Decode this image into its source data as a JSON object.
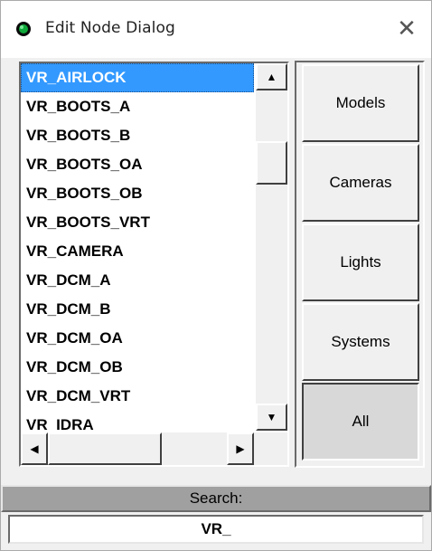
{
  "window": {
    "title": "Edit Node Dialog",
    "close_glyph": "✕",
    "icon": "green-sphere-icon"
  },
  "node_list": {
    "items": [
      "VR_AIRLOCK",
      "VR_BOOTS_A",
      "VR_BOOTS_B",
      "VR_BOOTS_OA",
      "VR_BOOTS_OB",
      "VR_BOOTS_VRT",
      "VR_CAMERA",
      "VR_DCM_A",
      "VR_DCM_B",
      "VR_DCM_OA",
      "VR_DCM_OB",
      "VR_DCM_VRT",
      "VR_IDRA"
    ],
    "selected_index": 0,
    "scroll_up_glyph": "▲",
    "scroll_down_glyph": "▼",
    "scroll_left_glyph": "◀",
    "scroll_right_glyph": "▶"
  },
  "categories": {
    "buttons": [
      "Models",
      "Cameras",
      "Lights",
      "Systems",
      "All"
    ],
    "active": "All"
  },
  "search": {
    "label": "Search:",
    "value": "VR_"
  },
  "colors": {
    "selection": "#3399ff",
    "icon": "#0a8a2a"
  }
}
